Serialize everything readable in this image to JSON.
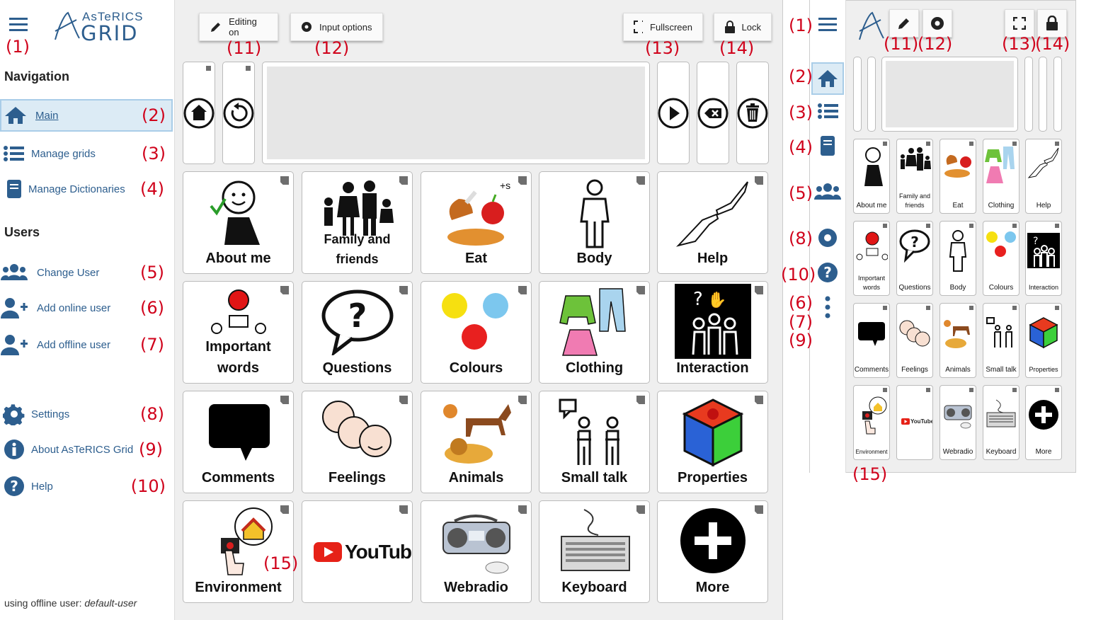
{
  "app": {
    "logo_top": "AsTeRICS",
    "logo_bottom": "GRID"
  },
  "sidebar": {
    "nav_title": "Navigation",
    "nav_items": [
      {
        "label": "Main",
        "marker": "(2)",
        "icon": "home-icon",
        "active": true
      },
      {
        "label": "Manage grids",
        "marker": "(3)",
        "icon": "list-icon"
      },
      {
        "label": "Manage Dictionaries",
        "marker": "(4)",
        "icon": "book-icon"
      }
    ],
    "users_title": "Users",
    "user_items": [
      {
        "label": "Change User",
        "marker": "(5)",
        "icon": "users-icon"
      },
      {
        "label": "Add online user",
        "marker": "(6)",
        "icon": "add-user-icon"
      },
      {
        "label": "Add offline user",
        "marker": "(7)",
        "icon": "add-user-icon"
      }
    ],
    "other_items": [
      {
        "label": "Settings",
        "marker": "(8)",
        "icon": "gear-icon"
      },
      {
        "label": "About AsTeRICS Grid",
        "marker": "(9)",
        "icon": "info-icon"
      },
      {
        "label": "Help",
        "marker": "(10)",
        "icon": "question-icon"
      }
    ],
    "menu_marker": "(1)",
    "footer_prefix": "using offline user: ",
    "footer_user": "default-user"
  },
  "toolbar": {
    "editing": "Editing on",
    "input": "Input options",
    "fullscreen": "Fullscreen",
    "lock": "Lock",
    "m11": "(11)",
    "m12": "(12)",
    "m13": "(13)",
    "m14": "(14)"
  },
  "grid": {
    "cells": [
      [
        "About me",
        "Family and friends",
        "Eat",
        "Body",
        "Help"
      ],
      [
        "Important words",
        "Questions",
        "Colours",
        "Clothing",
        "Interaction"
      ],
      [
        "Comments",
        "Feelings",
        "Animals",
        "Small talk",
        "Properties"
      ],
      [
        "Environment",
        "",
        "Webradio",
        "Keyboard",
        "More"
      ]
    ],
    "youtube_text": "YouTube",
    "m15": "(15)"
  },
  "preview": {
    "markers": {
      "m1": "(1)",
      "m2": "(2)",
      "m3": "(3)",
      "m4": "(4)",
      "m5": "(5)",
      "m8": "(8)",
      "m10": "(10)",
      "m6": "(6)",
      "m7": "(7)",
      "m9": "(9)",
      "m11": "(11)",
      "m12": "(12)",
      "m13": "(13)",
      "m14": "(14)",
      "m15": "(15)"
    },
    "cells": [
      [
        "About me",
        "Family and friends",
        "Eat",
        "Clothing",
        "Help"
      ],
      [
        "Important words",
        "Questions",
        "Body",
        "Colours",
        "Interaction"
      ],
      [
        "Comments",
        "Feelings",
        "Animals",
        "Small talk",
        "Properties"
      ],
      [
        "Environment",
        "",
        "Webradio",
        "Keyboard",
        "More"
      ]
    ],
    "youtube_text": "YouTube"
  },
  "colors": {
    "accent": "#2d5e8e",
    "marker": "#d0021b",
    "active_bg": "#dcebf5"
  }
}
